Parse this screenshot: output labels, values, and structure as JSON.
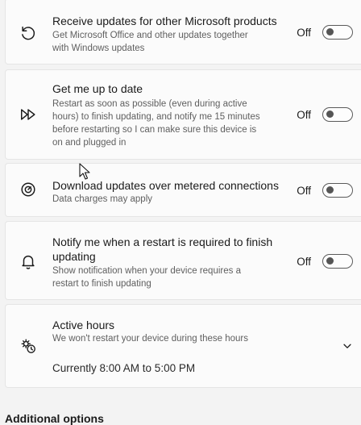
{
  "items": [
    {
      "title": "Receive updates for other Microsoft products",
      "desc1": "Get Microsoft Office and other updates together",
      "desc2": "with Windows updates",
      "state": "Off",
      "icon": "refresh-icon"
    },
    {
      "title": "Get me up to date",
      "desc1": "Restart as soon as possible (even during active",
      "desc2": "hours) to finish updating, and notify me 15 minutes",
      "desc3": "before restarting so I can make sure this device is",
      "desc4": "on and plugged in",
      "state": "Off",
      "icon": "fast-forward-icon"
    },
    {
      "title": "Download updates over metered connections",
      "desc1": "Data charges may apply",
      "state": "Off",
      "icon": "gauge-icon"
    },
    {
      "title1": "Notify me when a restart is required to finish",
      "title2": "updating",
      "desc1": "Show notification when your device requires a",
      "desc2": "restart to finish updating",
      "state": "Off",
      "icon": "bell-icon"
    }
  ],
  "active_hours": {
    "title": "Active hours",
    "desc": "We won't restart your device during these hours",
    "value": "Currently 8:00 AM to 5:00 PM",
    "icon": "clock-settings-icon"
  },
  "next_section": "Additional options"
}
